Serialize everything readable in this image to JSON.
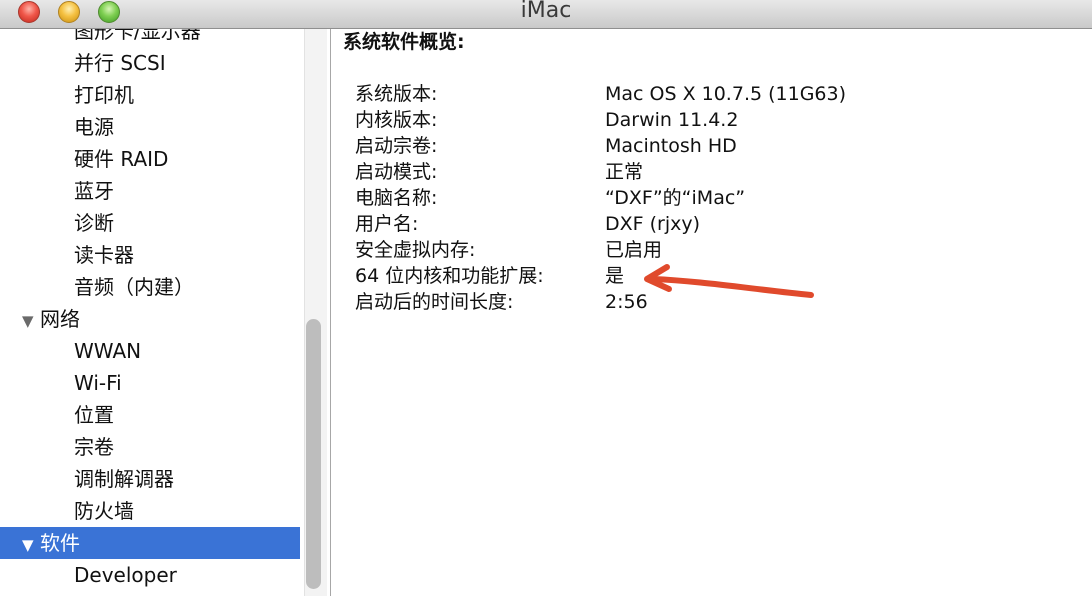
{
  "window": {
    "title": "iMac"
  },
  "sidebar": {
    "items": [
      {
        "label": "图形卡/显示器",
        "type": "child"
      },
      {
        "label": "并行 SCSI",
        "type": "child"
      },
      {
        "label": "打印机",
        "type": "child"
      },
      {
        "label": "电源",
        "type": "child"
      },
      {
        "label": "硬件 RAID",
        "type": "child"
      },
      {
        "label": "蓝牙",
        "type": "child"
      },
      {
        "label": "诊断",
        "type": "child"
      },
      {
        "label": "读卡器",
        "type": "child"
      },
      {
        "label": "音频（内建）",
        "type": "child"
      },
      {
        "label": "网络",
        "type": "group",
        "disclosure": "▼"
      },
      {
        "label": "WWAN",
        "type": "child"
      },
      {
        "label": "Wi-Fi",
        "type": "child"
      },
      {
        "label": "位置",
        "type": "child"
      },
      {
        "label": "宗卷",
        "type": "child"
      },
      {
        "label": "调制解调器",
        "type": "child"
      },
      {
        "label": "防火墙",
        "type": "child"
      },
      {
        "label": "软件",
        "type": "group",
        "disclosure": "▼",
        "selected": true
      },
      {
        "label": "Developer",
        "type": "child"
      }
    ]
  },
  "main": {
    "section_title": "系统软件概览:",
    "rows": [
      {
        "label": "系统版本:",
        "value": "Mac OS X 10.7.5 (11G63)"
      },
      {
        "label": "内核版本:",
        "value": "Darwin 11.4.2"
      },
      {
        "label": "启动宗卷:",
        "value": "Macintosh HD"
      },
      {
        "label": "启动模式:",
        "value": "正常"
      },
      {
        "label": "电脑名称:",
        "value": "“DXF”的“iMac”"
      },
      {
        "label": "用户名:",
        "value": "DXF (rjxy)"
      },
      {
        "label": "安全虚拟内存:",
        "value": "已启用"
      },
      {
        "label": "64 位内核和功能扩展:",
        "value": "是"
      },
      {
        "label": "启动后的时间长度:",
        "value": "2:56"
      }
    ]
  },
  "annotation": {
    "icon": "red-arrow-icon",
    "color": "#e04a2c"
  },
  "colors": {
    "selection": "#3a73d6"
  }
}
